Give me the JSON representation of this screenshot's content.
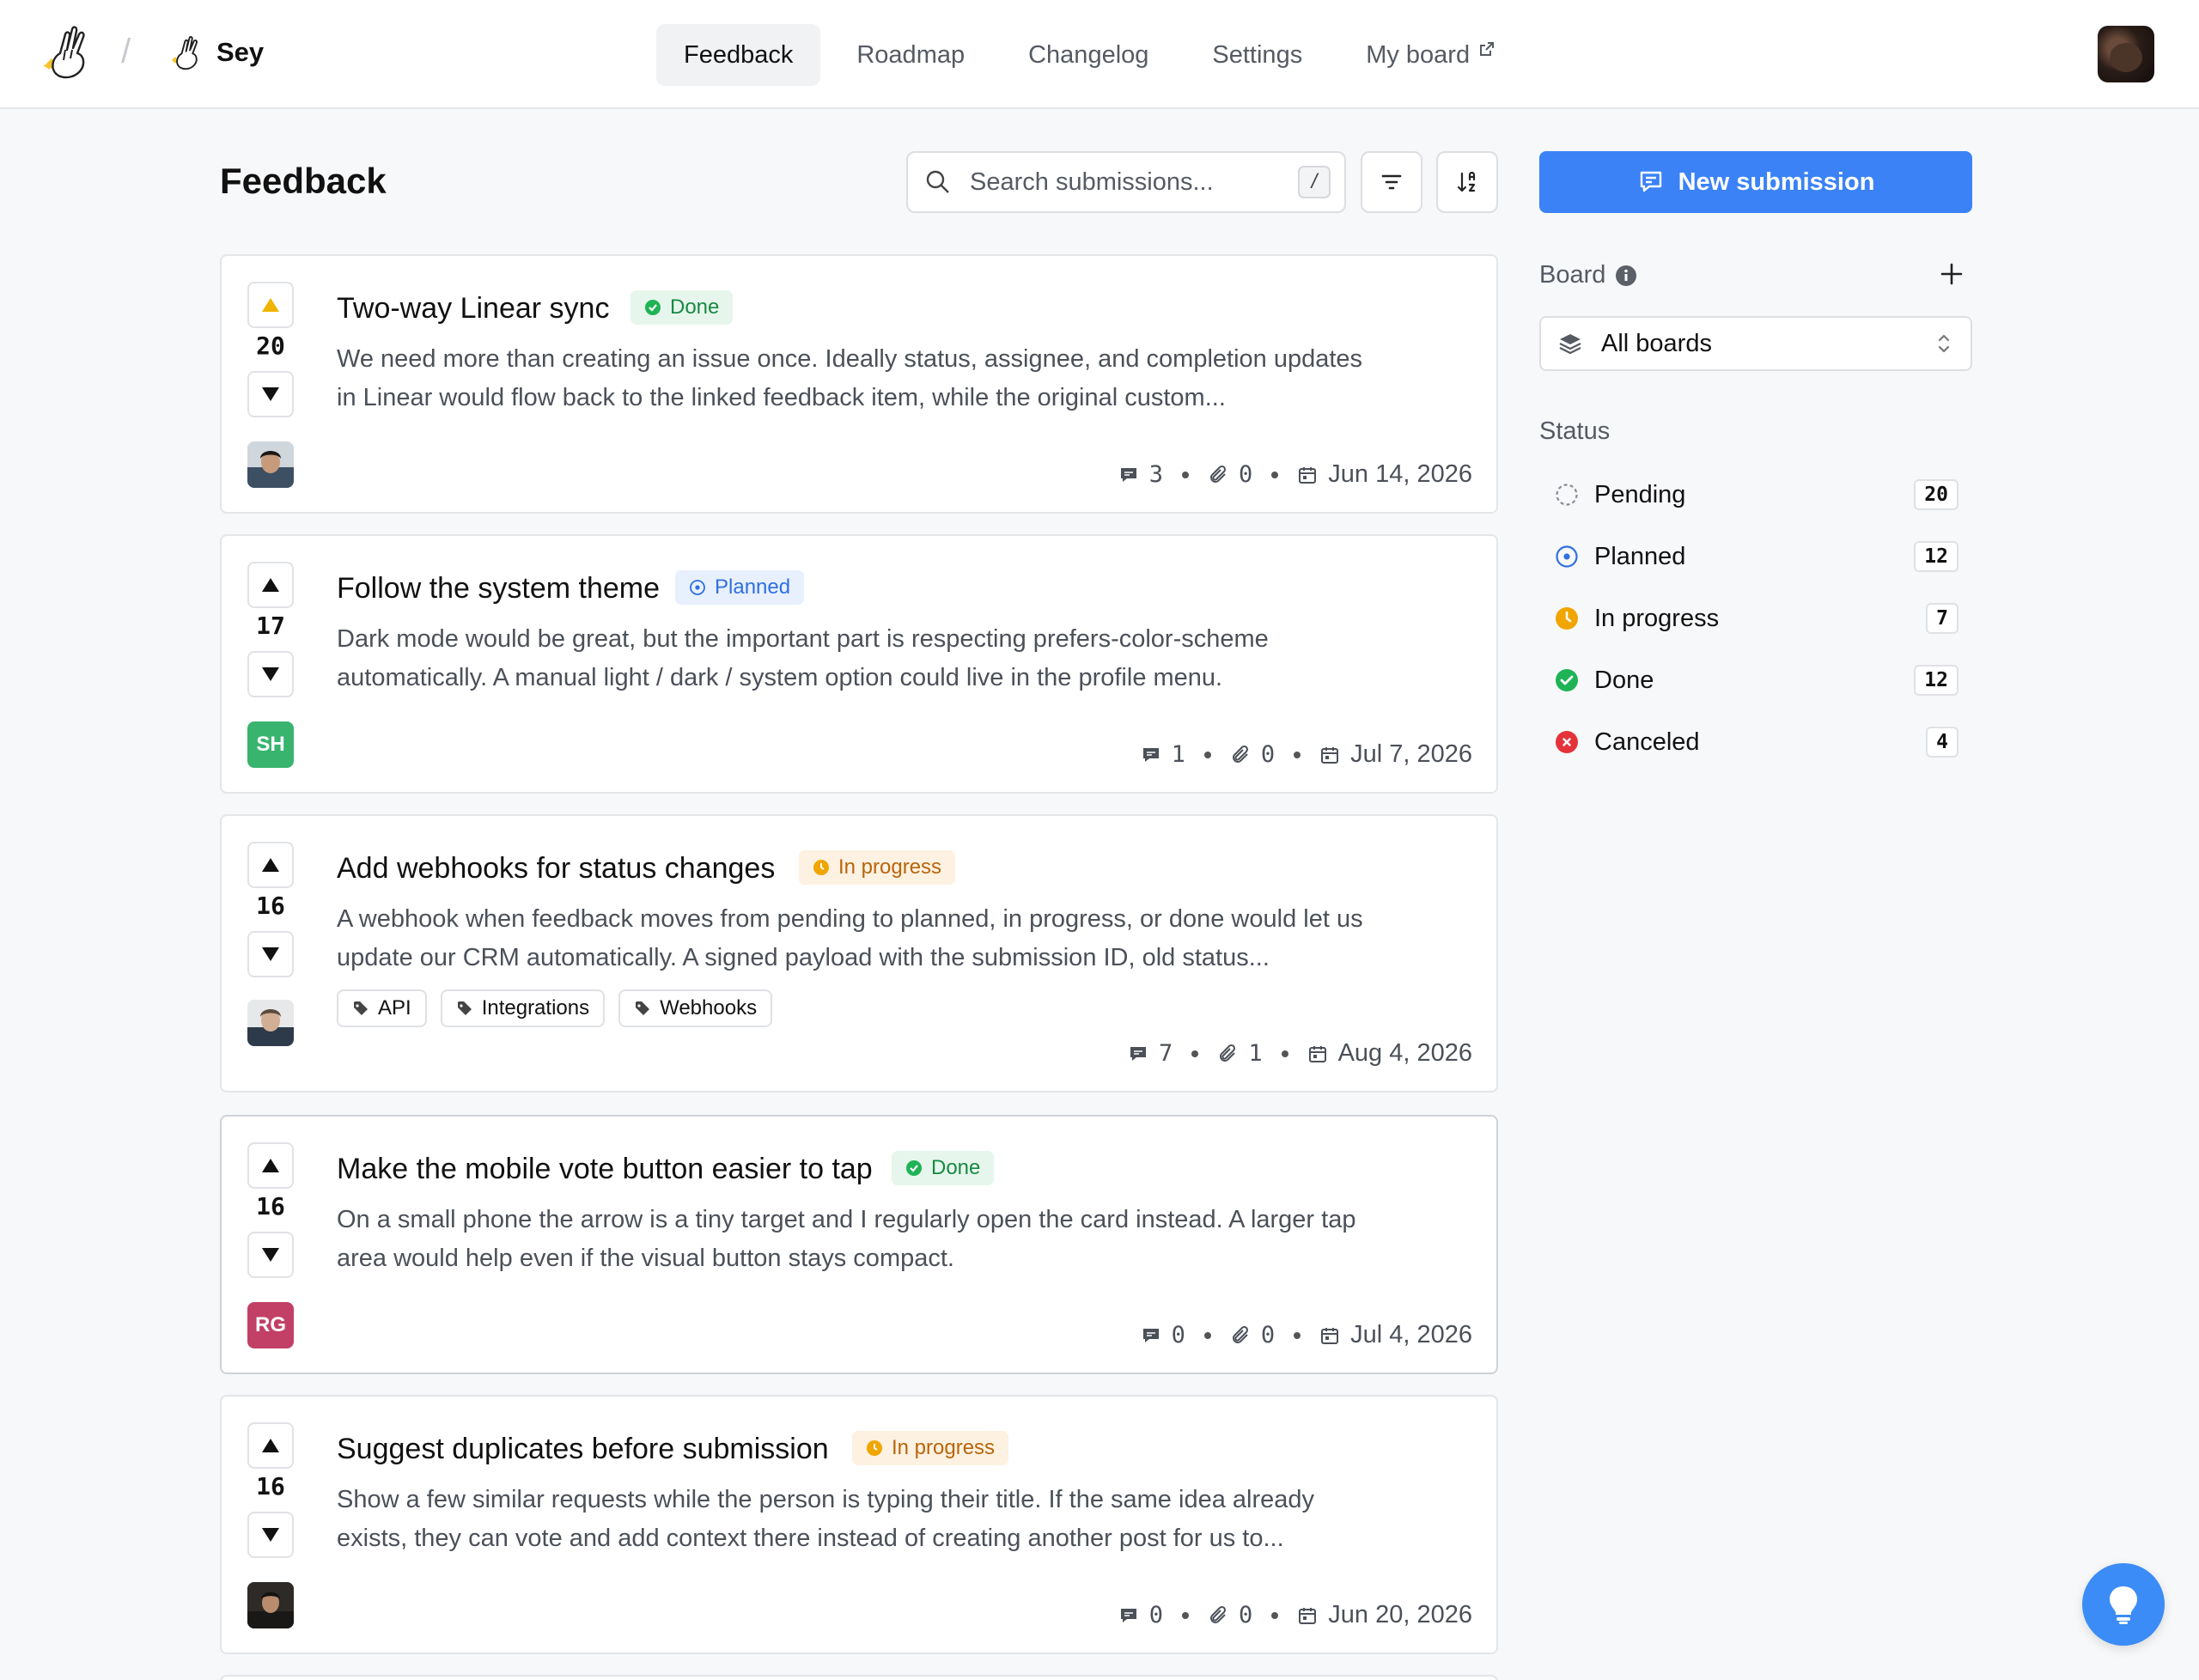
{
  "nav": {
    "org_name": "Sey",
    "separator": "/",
    "tabs": [
      {
        "label": "Feedback",
        "active": true
      },
      {
        "label": "Roadmap"
      },
      {
        "label": "Changelog"
      },
      {
        "label": "Settings"
      },
      {
        "label": "My board",
        "icon": "external-link-icon"
      }
    ]
  },
  "header": {
    "title": "Feedback",
    "search_placeholder": "Search submissions...",
    "search_shortcut": "/",
    "new_button": "New submission"
  },
  "cards": [
    {
      "title": "Two-way Linear sync",
      "status": "Done",
      "votes": "20",
      "upvoted": true,
      "description": "We need more than creating an issue once. Ideally status, assignee, and completion updates in Linear would flow back to the linked feedback item, while the original custom...",
      "comments": "3",
      "attachments": "0",
      "date": "Jun 14, 2026",
      "author": {
        "type": "photo"
      }
    },
    {
      "title": "Follow the system theme",
      "status": "Planned",
      "votes": "17",
      "description": "Dark mode would be great, but the important part is respecting prefers-color-scheme automatically. A manual light / dark / system option could live in the profile menu.",
      "comments": "1",
      "attachments": "0",
      "date": "Jul 7, 2026",
      "author": {
        "type": "initials",
        "initials": "SH",
        "color": "#38b46f"
      }
    },
    {
      "title": "Add webhooks for status changes",
      "status": "In progress",
      "votes": "16",
      "description": "A webhook when feedback moves from pending to planned, in progress, or done would let us update our CRM automatically. A signed payload with the submission ID, old status...",
      "tags": [
        "API",
        "Integrations",
        "Webhooks"
      ],
      "comments": "7",
      "attachments": "1",
      "date": "Aug 4, 2026",
      "author": {
        "type": "photo"
      }
    },
    {
      "title": "Make the mobile vote button easier to tap",
      "status": "Done",
      "votes": "16",
      "description": "On a small phone the arrow is a tiny target and I regularly open the card instead. A larger tap area would help even if the visual button stays compact.",
      "comments": "0",
      "attachments": "0",
      "date": "Jul 4, 2026",
      "author": {
        "type": "initials",
        "initials": "RG",
        "color": "#c23f66"
      }
    },
    {
      "title": "Suggest duplicates before submission",
      "status": "In progress",
      "votes": "16",
      "description": "Show a few similar requests while the person is typing their title. If the same idea already exists, they can vote and add context there instead of creating another post for us to...",
      "comments": "0",
      "attachments": "0",
      "date": "Jun 20, 2026",
      "author": {
        "type": "photo"
      }
    }
  ],
  "sidebar": {
    "board_label": "Board",
    "board_value": "All boards",
    "status_label": "Status",
    "statuses": [
      {
        "label": "Pending",
        "count": "20",
        "color": "#888c94"
      },
      {
        "label": "Planned",
        "count": "12",
        "color": "#2f6fe0"
      },
      {
        "label": "In progress",
        "count": "7",
        "color": "#f0a500"
      },
      {
        "label": "Done",
        "count": "12",
        "color": "#1fb355"
      },
      {
        "label": "Canceled",
        "count": "4",
        "color": "#e5333a"
      }
    ]
  },
  "colors": {
    "accent": "#3b82f6",
    "done": "#1fb355",
    "planned": "#2f6fe0",
    "in_progress": "#f0a500",
    "canceled": "#e5333a",
    "upvoted": "#f0b400"
  }
}
